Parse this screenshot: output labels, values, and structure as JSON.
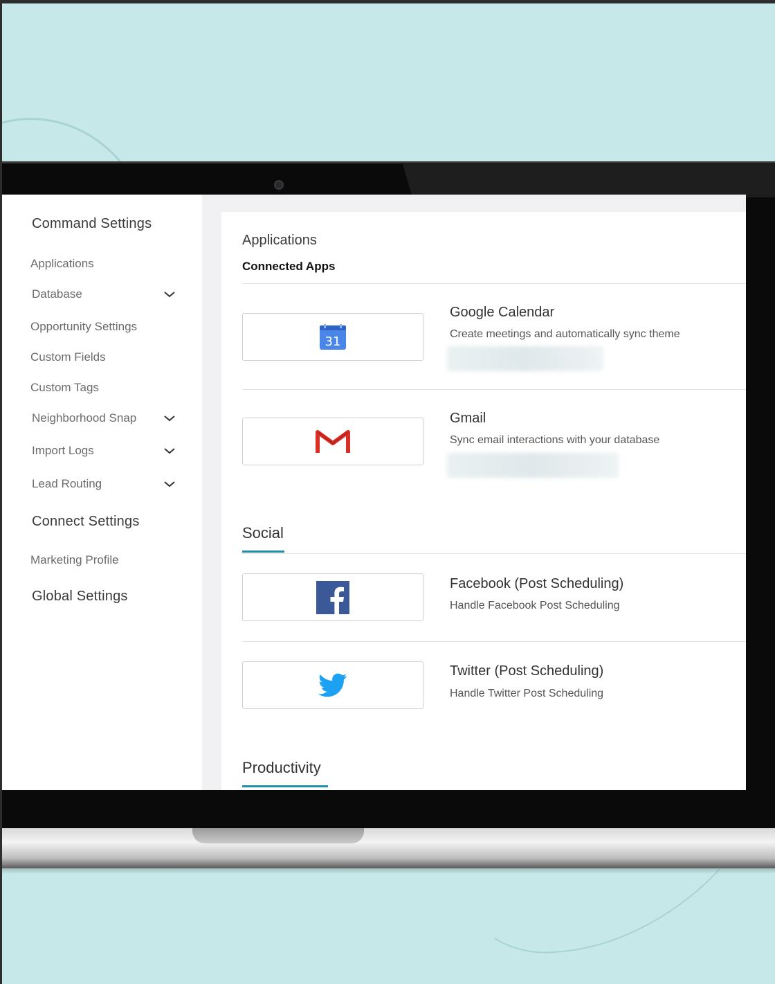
{
  "colors": {
    "background": "#c6e8e8",
    "accent": "#1f8fa8",
    "google_blue": "#4a86e8",
    "gmail_red": "#d93025",
    "facebook_blue": "#3b5998",
    "twitter_blue": "#1da1f2"
  },
  "sidebar": {
    "groups": [
      {
        "label": "Command Settings",
        "items": [
          {
            "label": "Applications",
            "expandable": false
          },
          {
            "label": "Database",
            "expandable": true
          },
          {
            "label": "Opportunity Settings",
            "expandable": false
          },
          {
            "label": "Custom Fields",
            "expandable": false
          },
          {
            "label": "Custom Tags",
            "expandable": false
          },
          {
            "label": "Neighborhood Snap",
            "expandable": true
          },
          {
            "label": "Import Logs",
            "expandable": true
          },
          {
            "label": "Lead Routing",
            "expandable": true
          }
        ]
      },
      {
        "label": "Connect Settings",
        "items": [
          {
            "label": "Marketing Profile",
            "expandable": false
          }
        ]
      },
      {
        "label": "Global Settings",
        "items": []
      }
    ]
  },
  "main": {
    "title": "Applications",
    "subtitle": "Connected Apps",
    "connected_apps": [
      {
        "name": "Google Calendar",
        "description": "Create meetings and automatically sync theme",
        "icon": "google-calendar-icon",
        "icon_text": "31"
      },
      {
        "name": "Gmail",
        "description": "Sync email interactions with your database",
        "icon": "gmail-icon"
      }
    ],
    "sections": [
      {
        "title": "Social",
        "apps": [
          {
            "name": "Facebook (Post Scheduling)",
            "description": "Handle Facebook Post Scheduling",
            "icon": "facebook-icon"
          },
          {
            "name": "Twitter (Post Scheduling)",
            "description": "Handle Twitter Post Scheduling",
            "icon": "twitter-icon"
          }
        ]
      },
      {
        "title": "Productivity",
        "apps": []
      }
    ]
  }
}
